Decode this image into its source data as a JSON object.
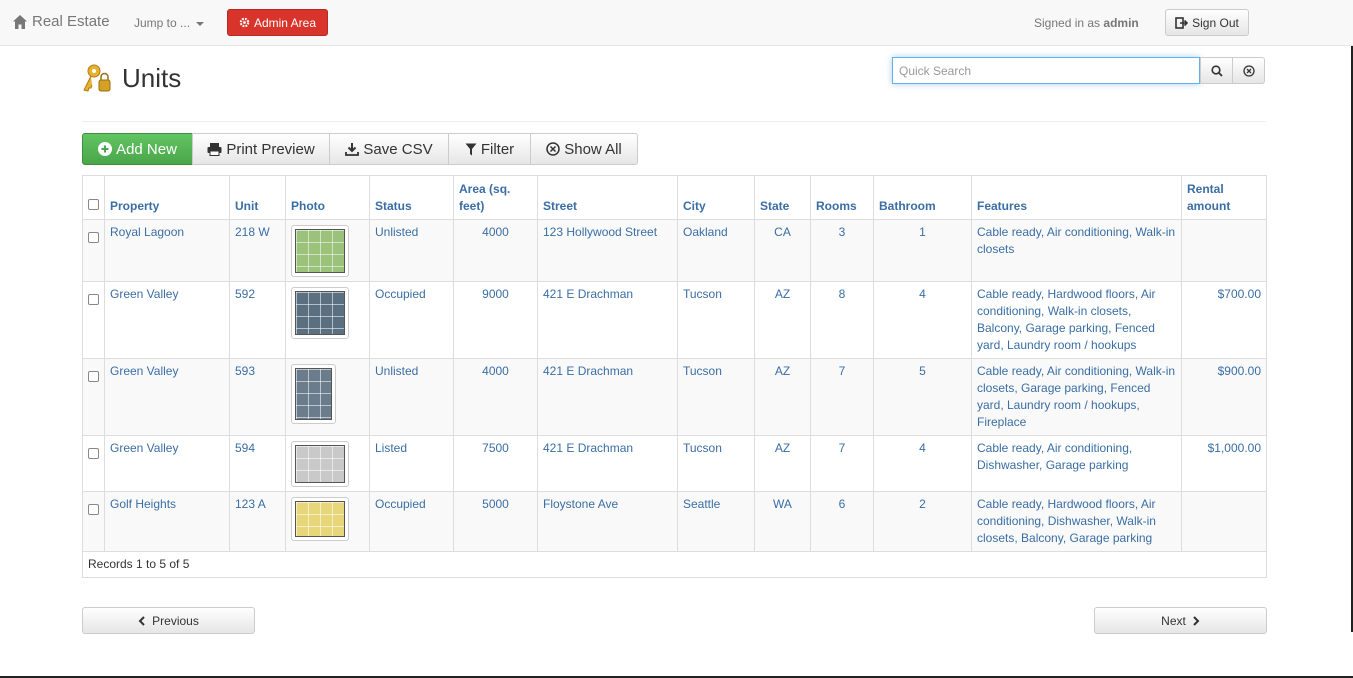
{
  "nav": {
    "brand": "Real Estate",
    "jump": "Jump to ...",
    "admin": "Admin Area",
    "signed_prefix": "Signed in as",
    "user": "admin",
    "signout": "Sign Out"
  },
  "page": {
    "title": "Units",
    "search_placeholder": "Quick Search"
  },
  "toolbar": {
    "add": "Add New",
    "print": "Print Preview",
    "csv": "Save CSV",
    "filter": "Filter",
    "showall": "Show All"
  },
  "table": {
    "headers": [
      "Property",
      "Unit",
      "Photo",
      "Status",
      "Area (sq. feet)",
      "Street",
      "City",
      "State",
      "Rooms",
      "Bathroom",
      "Features",
      "Rental amount"
    ],
    "rows": [
      {
        "property": "Royal Lagoon",
        "unit": "218 W",
        "photo_color": "#9bc27a",
        "status": "Unlisted",
        "area": "4000",
        "street": "123 Hollywood Street",
        "city": "Oakland",
        "state": "CA",
        "rooms": "3",
        "bath": "1",
        "features": "Cable ready, Air conditioning, Walk-in closets",
        "rent": ""
      },
      {
        "property": "Green Valley",
        "unit": "592",
        "photo_color": "#5a6f80",
        "status": "Occupied",
        "area": "9000",
        "street": "421 E Drachman",
        "city": "Tucson",
        "state": "AZ",
        "rooms": "8",
        "bath": "4",
        "features": "Cable ready, Hardwood floors, Air conditioning, Walk-in closets, Balcony, Garage parking, Fenced yard, Laundry room / hookups",
        "rent": "$700.00"
      },
      {
        "property": "Green Valley",
        "unit": "593",
        "photo_color": "#6b7c8d",
        "status": "Unlisted",
        "area": "4000",
        "street": "421 E Drachman",
        "city": "Tucson",
        "state": "AZ",
        "rooms": "7",
        "bath": "5",
        "features": "Cable ready, Air conditioning, Walk-in closets, Garage parking, Fenced yard, Laundry room / hookups, Fireplace",
        "rent": "$900.00"
      },
      {
        "property": "Green Valley",
        "unit": "594",
        "photo_color": "#c9c9c9",
        "status": "Listed",
        "area": "7500",
        "street": "421 E Drachman",
        "city": "Tucson",
        "state": "AZ",
        "rooms": "7",
        "bath": "4",
        "features": "Cable ready, Air conditioning, Dishwasher, Garage parking",
        "rent": "$1,000.00"
      },
      {
        "property": "Golf Heights",
        "unit": "123 A",
        "photo_color": "#e8d77a",
        "status": "Occupied",
        "area": "5000",
        "street": "Floystone Ave",
        "city": "Seattle",
        "state": "WA",
        "rooms": "6",
        "bath": "2",
        "features": "Cable ready, Hardwood floors, Air conditioning, Dishwasher, Walk-in closets, Balcony, Garage parking",
        "rent": ""
      }
    ],
    "records": "Records 1 to 5 of 5"
  },
  "pager": {
    "prev": "Previous",
    "next": "Next"
  }
}
